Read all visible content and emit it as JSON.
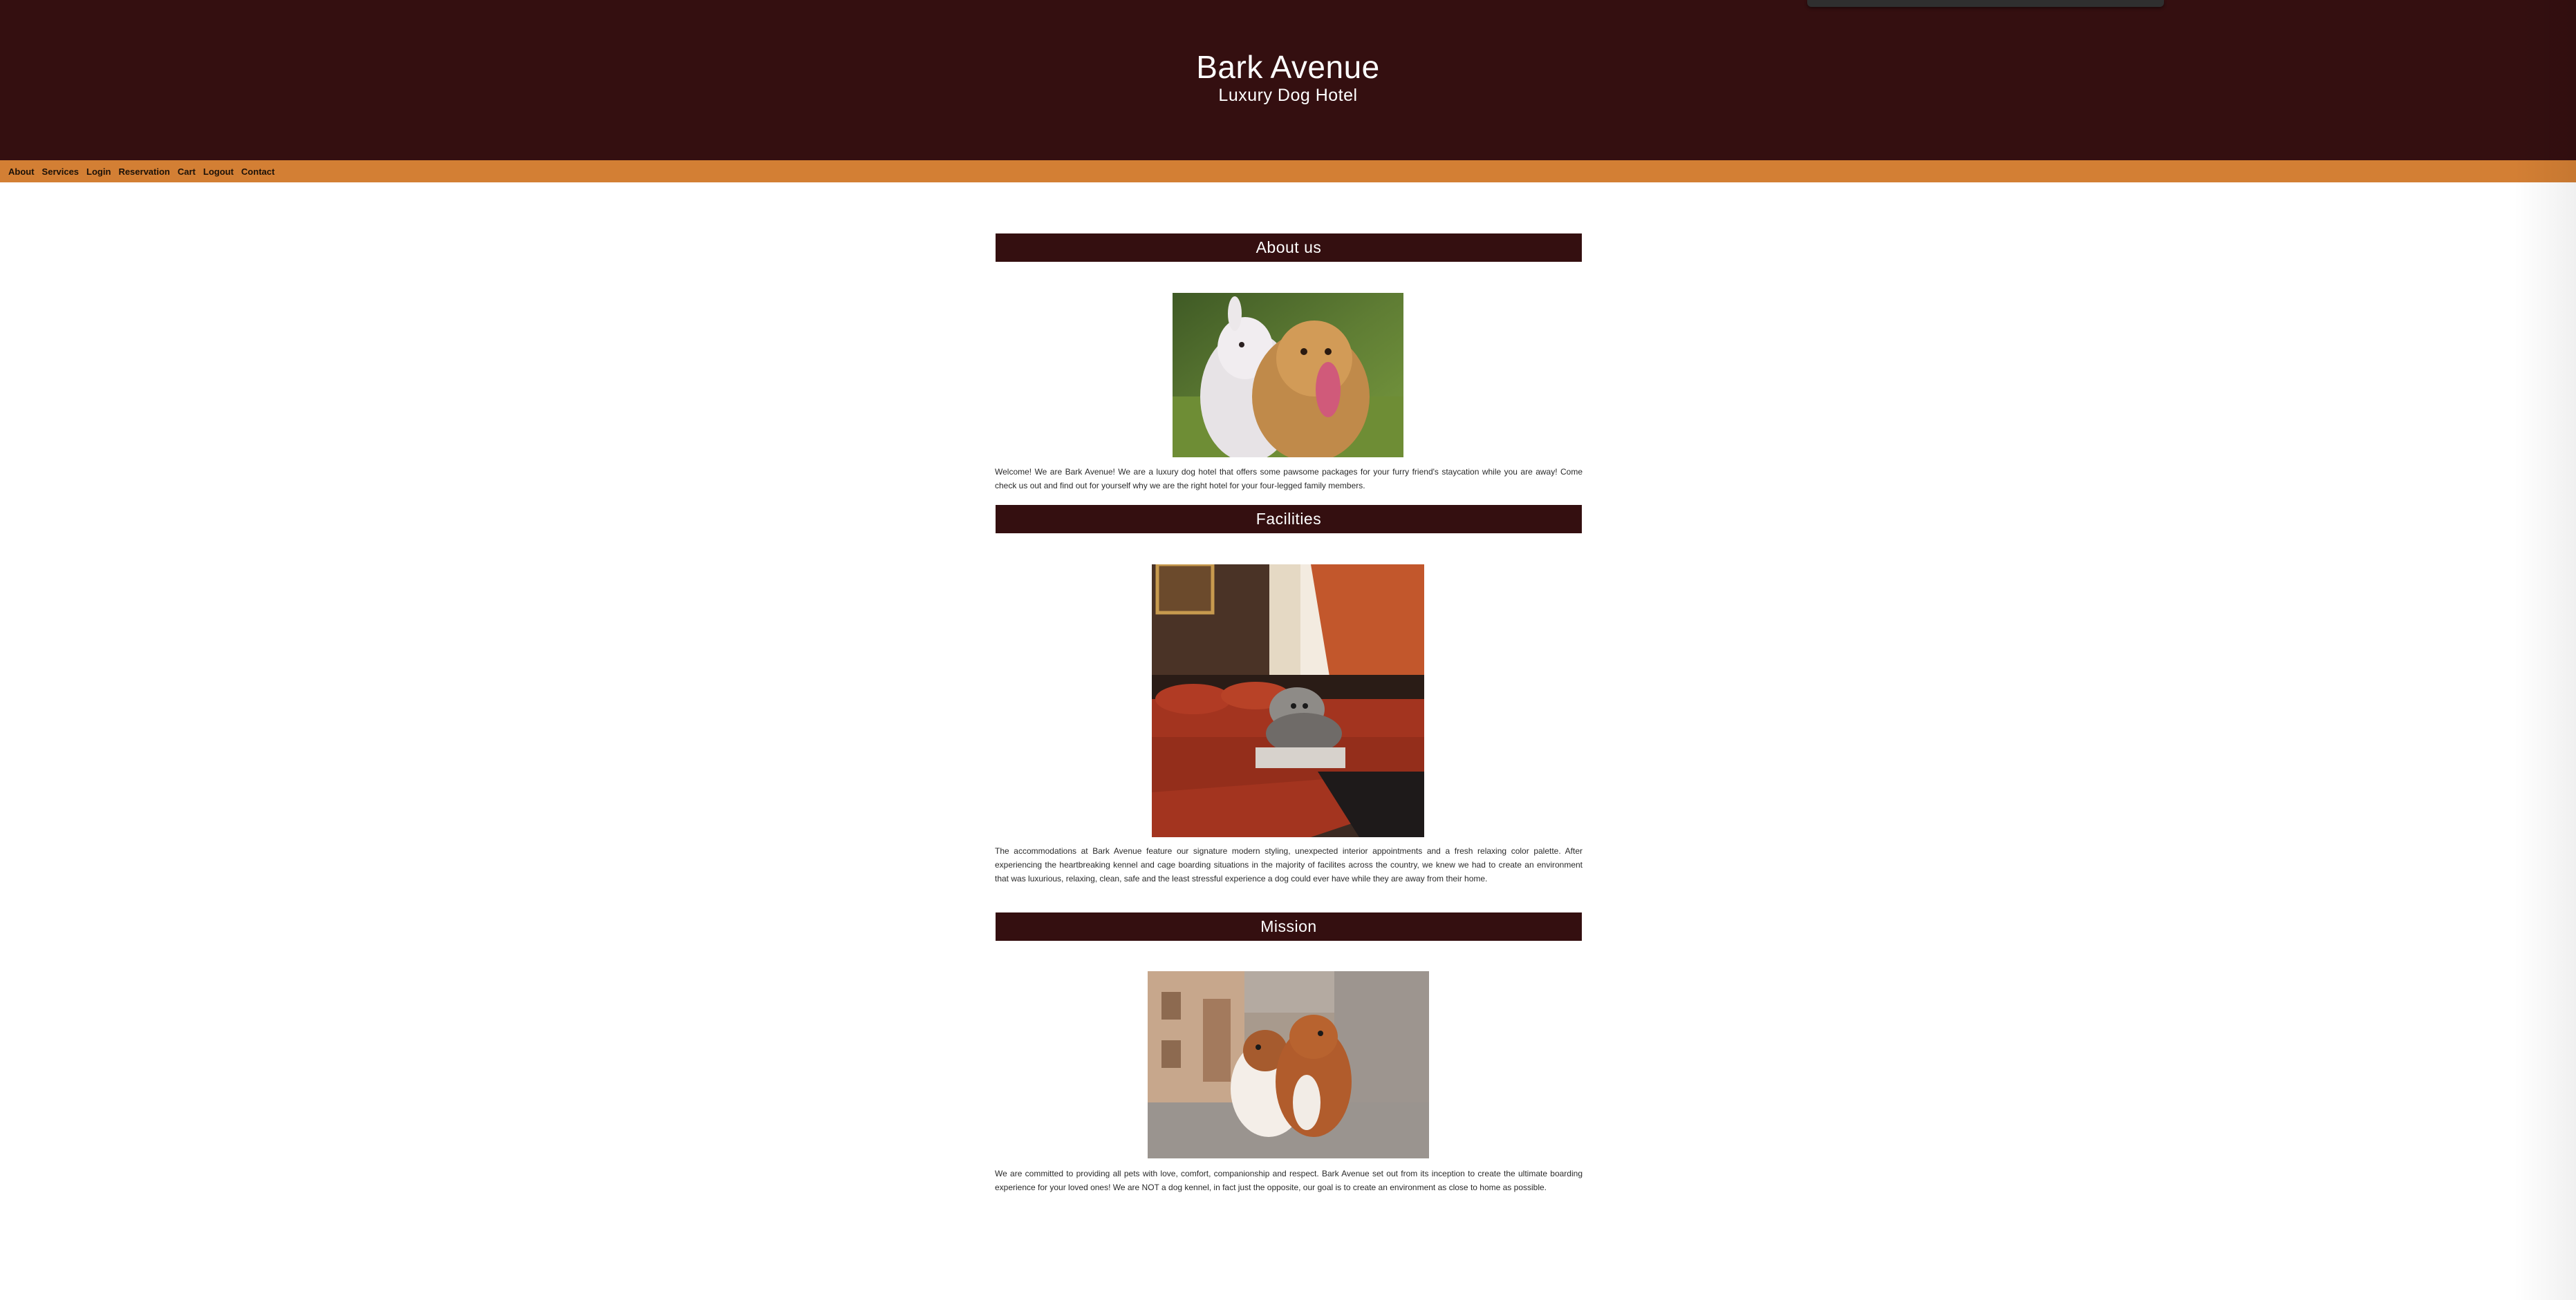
{
  "site": {
    "title": "Bark Avenue",
    "subtitle": "Luxury Dog Hotel"
  },
  "nav": {
    "items": [
      {
        "label": "About"
      },
      {
        "label": "Services"
      },
      {
        "label": "Login"
      },
      {
        "label": "Reservation"
      },
      {
        "label": "Cart"
      },
      {
        "label": "Logout"
      },
      {
        "label": "Contact"
      }
    ]
  },
  "sections": [
    {
      "heading": "About us",
      "image": "two-dogs-playing",
      "text": "Welcome! We are Bark Avenue! We are a luxury dog hotel that offers some pawsome packages for your furry friend's staycation while you are away! Come check us out and find out for yourself why we are the right hotel for your four-legged family members."
    },
    {
      "heading": "Facilities",
      "image": "dog-on-hotel-bed",
      "text": "The accommodations at Bark Avenue feature our signature modern styling, unexpected interior appointments and a fresh relaxing color palette. After experiencing the heartbreaking kennel and cage boarding situations in the majority of facilites across the country, we knew we had to create an environment that was luxurious, relaxing, clean, safe and the least stressful experience a dog could ever have while they are away from their home."
    },
    {
      "heading": "Mission",
      "image": "two-dogs-hugging-street",
      "text": "We are committed to providing all pets with love, comfort, companionship and respect. Bark Avenue set out from its inception to create the ultimate boarding experience for your loved ones! We are NOT a dog kennel, in fact just the opposite, our goal is to create an environment as close to home as possible."
    }
  ],
  "colors": {
    "header_bg": "#340f10",
    "nav_bg": "#d37f34",
    "heading_bg": "#340f10",
    "text": "#2a2a2a"
  }
}
